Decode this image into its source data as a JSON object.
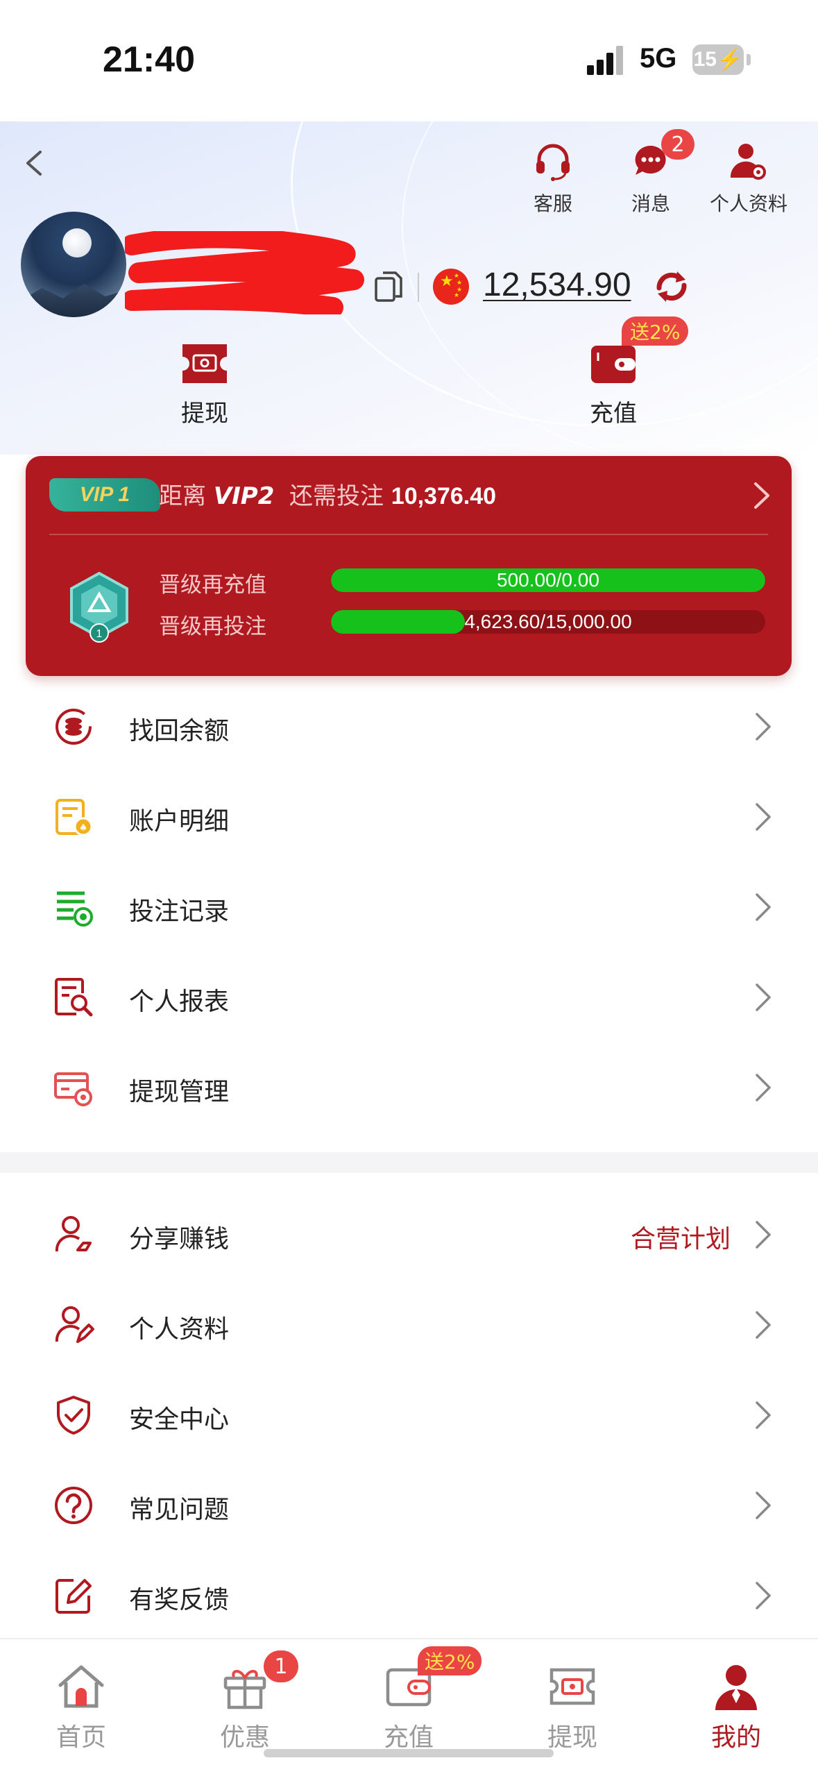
{
  "status_bar": {
    "time": "21:40",
    "network": "5G",
    "battery": "15"
  },
  "header": {
    "actions": [
      {
        "label": "客服",
        "icon": "headset-icon"
      },
      {
        "label": "消息",
        "icon": "chat-bubble-icon",
        "badge": "2"
      },
      {
        "label": "个人资料",
        "icon": "user-gear-icon"
      }
    ],
    "balance": "12,534.90",
    "withdraw_label": "提现",
    "deposit_label": "充值",
    "deposit_promo": "送2%"
  },
  "vip": {
    "badge": "VIP 1",
    "next_prefix": "距离",
    "next_level": "VIP2",
    "need_text": "还需投注",
    "need_amount": "10,376.40",
    "shield_level": "1",
    "progress": [
      {
        "label": "晋级再充值",
        "text": "500.00/0.00",
        "fraction": 1.0
      },
      {
        "label": "晋级再投注",
        "text": "4,623.60/15,000.00",
        "fraction": 0.308
      }
    ]
  },
  "menu_group_1": [
    {
      "label": "找回余额",
      "icon": "coins-recover-icon"
    },
    {
      "label": "账户明细",
      "icon": "account-detail-icon"
    },
    {
      "label": "投注记录",
      "icon": "bet-record-icon"
    },
    {
      "label": "个人报表",
      "icon": "report-search-icon"
    },
    {
      "label": "提现管理",
      "icon": "withdraw-manage-icon"
    }
  ],
  "menu_group_2": [
    {
      "label": "分享赚钱",
      "icon": "share-user-icon",
      "extra": "合营计划"
    },
    {
      "label": "个人资料",
      "icon": "user-edit-icon"
    },
    {
      "label": "安全中心",
      "icon": "shield-check-icon"
    },
    {
      "label": "常见问题",
      "icon": "question-icon"
    },
    {
      "label": "有奖反馈",
      "icon": "feedback-edit-icon"
    }
  ],
  "bottom_nav": [
    {
      "label": "首页",
      "icon": "home-icon"
    },
    {
      "label": "优惠",
      "icon": "gift-icon",
      "badge": "1"
    },
    {
      "label": "充值",
      "icon": "wallet-icon",
      "promo": "送2%"
    },
    {
      "label": "提现",
      "icon": "ticket-cash-icon"
    },
    {
      "label": "我的",
      "icon": "profile-icon",
      "active": true
    }
  ],
  "colors": {
    "brand_red": "#b0191f",
    "progress_green": "#15c11a",
    "badge_red": "#e94545",
    "promo_yellow": "#ffe34d"
  }
}
